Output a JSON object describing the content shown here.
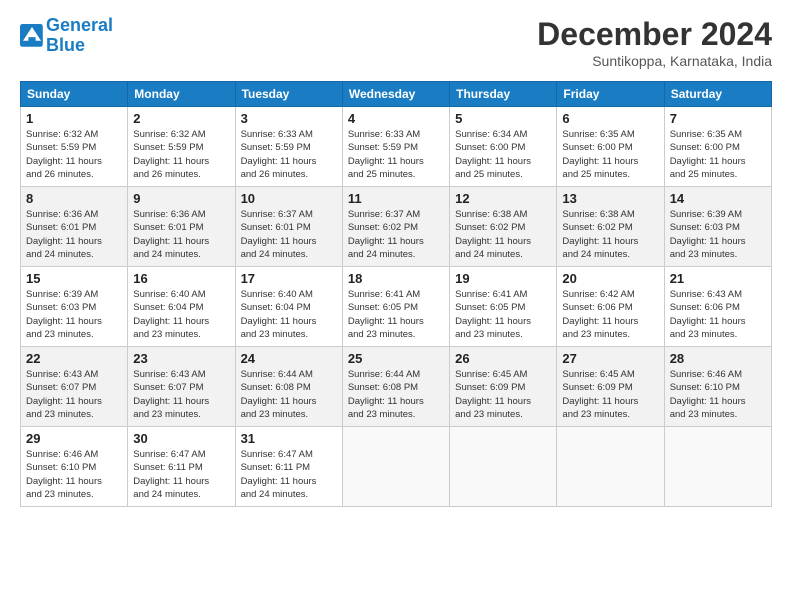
{
  "header": {
    "logo_line1": "General",
    "logo_line2": "Blue",
    "month_title": "December 2024",
    "subtitle": "Suntikoppa, Karnataka, India"
  },
  "weekdays": [
    "Sunday",
    "Monday",
    "Tuesday",
    "Wednesday",
    "Thursday",
    "Friday",
    "Saturday"
  ],
  "weeks": [
    [
      {
        "day": "1",
        "info": "Sunrise: 6:32 AM\nSunset: 5:59 PM\nDaylight: 11 hours\nand 26 minutes."
      },
      {
        "day": "2",
        "info": "Sunrise: 6:32 AM\nSunset: 5:59 PM\nDaylight: 11 hours\nand 26 minutes."
      },
      {
        "day": "3",
        "info": "Sunrise: 6:33 AM\nSunset: 5:59 PM\nDaylight: 11 hours\nand 26 minutes."
      },
      {
        "day": "4",
        "info": "Sunrise: 6:33 AM\nSunset: 5:59 PM\nDaylight: 11 hours\nand 25 minutes."
      },
      {
        "day": "5",
        "info": "Sunrise: 6:34 AM\nSunset: 6:00 PM\nDaylight: 11 hours\nand 25 minutes."
      },
      {
        "day": "6",
        "info": "Sunrise: 6:35 AM\nSunset: 6:00 PM\nDaylight: 11 hours\nand 25 minutes."
      },
      {
        "day": "7",
        "info": "Sunrise: 6:35 AM\nSunset: 6:00 PM\nDaylight: 11 hours\nand 25 minutes."
      }
    ],
    [
      {
        "day": "8",
        "info": "Sunrise: 6:36 AM\nSunset: 6:01 PM\nDaylight: 11 hours\nand 24 minutes."
      },
      {
        "day": "9",
        "info": "Sunrise: 6:36 AM\nSunset: 6:01 PM\nDaylight: 11 hours\nand 24 minutes."
      },
      {
        "day": "10",
        "info": "Sunrise: 6:37 AM\nSunset: 6:01 PM\nDaylight: 11 hours\nand 24 minutes."
      },
      {
        "day": "11",
        "info": "Sunrise: 6:37 AM\nSunset: 6:02 PM\nDaylight: 11 hours\nand 24 minutes."
      },
      {
        "day": "12",
        "info": "Sunrise: 6:38 AM\nSunset: 6:02 PM\nDaylight: 11 hours\nand 24 minutes."
      },
      {
        "day": "13",
        "info": "Sunrise: 6:38 AM\nSunset: 6:02 PM\nDaylight: 11 hours\nand 24 minutes."
      },
      {
        "day": "14",
        "info": "Sunrise: 6:39 AM\nSunset: 6:03 PM\nDaylight: 11 hours\nand 23 minutes."
      }
    ],
    [
      {
        "day": "15",
        "info": "Sunrise: 6:39 AM\nSunset: 6:03 PM\nDaylight: 11 hours\nand 23 minutes."
      },
      {
        "day": "16",
        "info": "Sunrise: 6:40 AM\nSunset: 6:04 PM\nDaylight: 11 hours\nand 23 minutes."
      },
      {
        "day": "17",
        "info": "Sunrise: 6:40 AM\nSunset: 6:04 PM\nDaylight: 11 hours\nand 23 minutes."
      },
      {
        "day": "18",
        "info": "Sunrise: 6:41 AM\nSunset: 6:05 PM\nDaylight: 11 hours\nand 23 minutes."
      },
      {
        "day": "19",
        "info": "Sunrise: 6:41 AM\nSunset: 6:05 PM\nDaylight: 11 hours\nand 23 minutes."
      },
      {
        "day": "20",
        "info": "Sunrise: 6:42 AM\nSunset: 6:06 PM\nDaylight: 11 hours\nand 23 minutes."
      },
      {
        "day": "21",
        "info": "Sunrise: 6:43 AM\nSunset: 6:06 PM\nDaylight: 11 hours\nand 23 minutes."
      }
    ],
    [
      {
        "day": "22",
        "info": "Sunrise: 6:43 AM\nSunset: 6:07 PM\nDaylight: 11 hours\nand 23 minutes."
      },
      {
        "day": "23",
        "info": "Sunrise: 6:43 AM\nSunset: 6:07 PM\nDaylight: 11 hours\nand 23 minutes."
      },
      {
        "day": "24",
        "info": "Sunrise: 6:44 AM\nSunset: 6:08 PM\nDaylight: 11 hours\nand 23 minutes."
      },
      {
        "day": "25",
        "info": "Sunrise: 6:44 AM\nSunset: 6:08 PM\nDaylight: 11 hours\nand 23 minutes."
      },
      {
        "day": "26",
        "info": "Sunrise: 6:45 AM\nSunset: 6:09 PM\nDaylight: 11 hours\nand 23 minutes."
      },
      {
        "day": "27",
        "info": "Sunrise: 6:45 AM\nSunset: 6:09 PM\nDaylight: 11 hours\nand 23 minutes."
      },
      {
        "day": "28",
        "info": "Sunrise: 6:46 AM\nSunset: 6:10 PM\nDaylight: 11 hours\nand 23 minutes."
      }
    ],
    [
      {
        "day": "29",
        "info": "Sunrise: 6:46 AM\nSunset: 6:10 PM\nDaylight: 11 hours\nand 23 minutes."
      },
      {
        "day": "30",
        "info": "Sunrise: 6:47 AM\nSunset: 6:11 PM\nDaylight: 11 hours\nand 24 minutes."
      },
      {
        "day": "31",
        "info": "Sunrise: 6:47 AM\nSunset: 6:11 PM\nDaylight: 11 hours\nand 24 minutes."
      },
      null,
      null,
      null,
      null
    ]
  ]
}
